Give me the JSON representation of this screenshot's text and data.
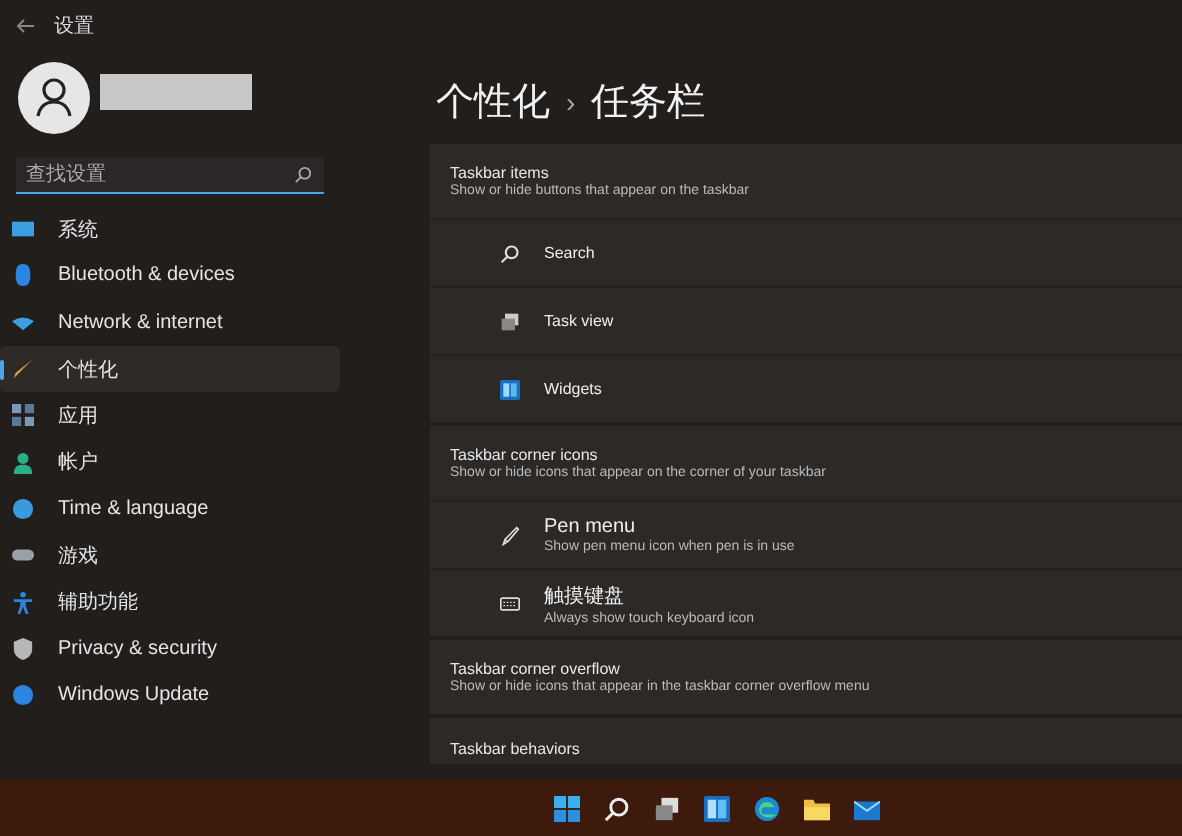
{
  "window": {
    "title": "设置"
  },
  "search": {
    "placeholder": "查找设置"
  },
  "nav": [
    {
      "label": "系统",
      "selected": false
    },
    {
      "label": "Bluetooth & devices",
      "selected": false
    },
    {
      "label": "Network & internet",
      "selected": false
    },
    {
      "label": "个性化",
      "selected": true
    },
    {
      "label": "应用",
      "selected": false
    },
    {
      "label": "帐户",
      "selected": false
    },
    {
      "label": "Time & language",
      "selected": false
    },
    {
      "label": "游戏",
      "selected": false
    },
    {
      "label": "辅助功能",
      "selected": false
    },
    {
      "label": "Privacy & security",
      "selected": false
    },
    {
      "label": "Windows Update",
      "selected": false
    }
  ],
  "breadcrumb": {
    "parent": "个性化",
    "separator": "›",
    "current": "任务栏"
  },
  "sections": [
    {
      "title": "Taskbar items",
      "subtitle": "Show or hide buttons that appear on the taskbar",
      "items": [
        {
          "label": "Search"
        },
        {
          "label": "Task view"
        },
        {
          "label": "Widgets"
        }
      ]
    },
    {
      "title": "Taskbar corner icons",
      "subtitle": "Show or hide icons that appear on the corner of your taskbar",
      "items": [
        {
          "label": "Pen menu",
          "description": "Show pen menu icon when pen is in use"
        },
        {
          "label": "触摸键盘",
          "description": "Always show touch keyboard icon"
        }
      ]
    },
    {
      "title": "Taskbar corner overflow",
      "subtitle": "Show or hide icons that appear in the taskbar corner overflow menu"
    },
    {
      "title": "Taskbar behaviors"
    }
  ]
}
